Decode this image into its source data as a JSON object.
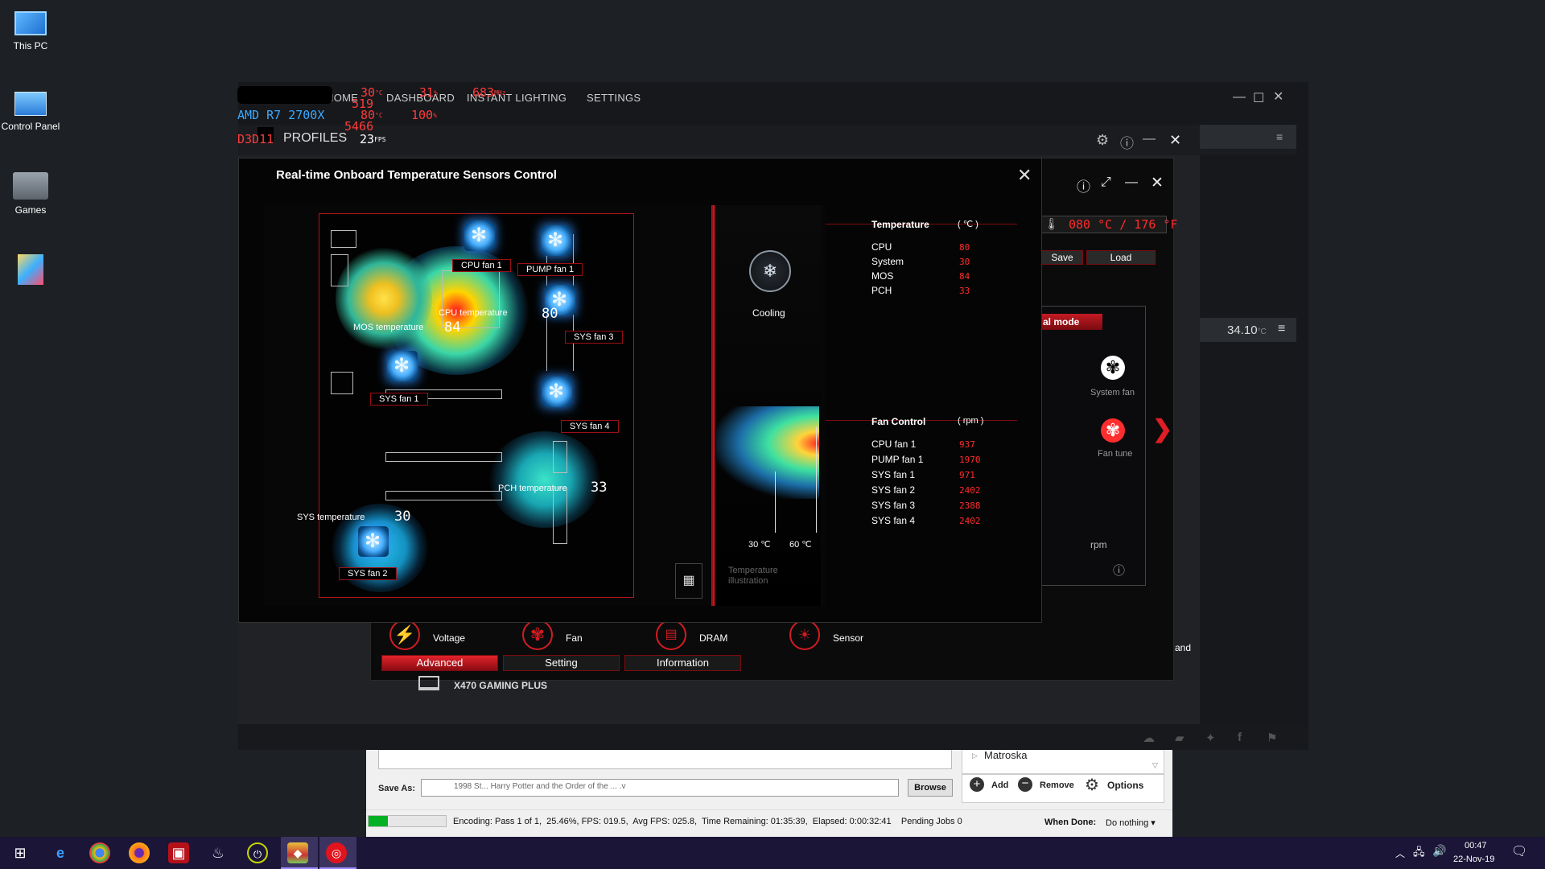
{
  "desktop": {
    "icons": [
      {
        "label": "This PC"
      },
      {
        "label": "Control Panel"
      },
      {
        "label": "Games"
      },
      {
        "label": ""
      }
    ]
  },
  "overlay": {
    "cpu_temp": "30",
    "cpu_temp_unit": "°C",
    "cpu_load": "31",
    "cpu_load_unit": "%",
    "cpu_clock": "683",
    "cpu_clock_unit": "MHz",
    "line2_value": "519",
    "cpu_name": "AMD R7 2700X",
    "gpu_temp": "80",
    "gpu_temp_unit": "°C",
    "gpu_load": "100",
    "gpu_load_unit": "%",
    "line4_value": "5466",
    "api": "D3D11",
    "fps": "23",
    "fps_unit": "FPS"
  },
  "main_nav": {
    "items": [
      "HOME",
      "DASHBOARD",
      "INSTANT LIGHTING",
      "SETTINGS"
    ],
    "profiles": "PROFILES"
  },
  "dialog": {
    "title": "Real-time Onboard Temperature Sensors Control",
    "labels": {
      "cpu_fan1": "CPU fan 1",
      "pump_fan1": "PUMP fan 1",
      "sys_fan3": "SYS fan 3",
      "sys_fan1": "SYS fan 1",
      "sys_fan4": "SYS fan 4",
      "sys_fan2": "SYS fan 2",
      "mos_temp": "MOS temperature",
      "cpu_temp": "CPU temperature",
      "pch_temp": "PCH temperature",
      "sys_temp": "SYS temperature"
    },
    "values": {
      "mos": "84",
      "cpu": "80",
      "pch": "33",
      "sys": "30"
    },
    "cooling": "Cooling",
    "scale_low": "30 ℃",
    "scale_high": "60 ℃",
    "temp_illus_1": "Temperature",
    "temp_illus_2": "illustration",
    "temperature": {
      "heading": "Temperature",
      "unit": "( ℃ )",
      "rows": [
        {
          "name": "CPU",
          "value": "80"
        },
        {
          "name": "System",
          "value": "30"
        },
        {
          "name": "MOS",
          "value": "84"
        },
        {
          "name": "PCH",
          "value": "33"
        }
      ]
    },
    "fan_control": {
      "heading": "Fan Control",
      "unit": "( rpm )",
      "rows": [
        {
          "name": "CPU fan 1",
          "value": "937"
        },
        {
          "name": "PUMP fan 1",
          "value": "1970"
        },
        {
          "name": "SYS fan 1",
          "value": "971"
        },
        {
          "name": "SYS fan 2",
          "value": "2402"
        },
        {
          "name": "SYS fan 3",
          "value": "2388"
        },
        {
          "name": "SYS fan 4",
          "value": "2402"
        }
      ]
    }
  },
  "behind": {
    "temp_readout": "080 °C / 176 °F",
    "save": "Save",
    "load": "Load",
    "mode_tab": "al mode",
    "system_fan": "System fan",
    "fan_tune": "Fan tune",
    "rpm": "rpm",
    "right_value": "34.10",
    "right_unit": "°C",
    "and": "and",
    "bottom_tabs": [
      {
        "label": "Voltage"
      },
      {
        "label": "Fan"
      },
      {
        "label": "DRAM"
      },
      {
        "label": "Sensor"
      }
    ],
    "buttons": [
      "Advanced",
      "Setting",
      "Information"
    ],
    "board_name": "X470 GAMING PLUS"
  },
  "handbrake": {
    "container": "Matroska",
    "save_as_label": "Save As:",
    "save_as_value": "1998 St... Harry Potter and the Order of the ... .v",
    "browse": "Browse",
    "add": "Add",
    "remove": "Remove",
    "options": "Options",
    "status": "Encoding: Pass 1 of 1,  25.46%, FPS: 019.5,  Avg FPS: 025.8,  Time Remaining: 01:35:39,  Elapsed: 0:00:32:41    Pending Jobs 0",
    "progress": 0.25,
    "when_done_label": "When Done:",
    "when_done_value": "Do nothing"
  },
  "taskbar": {
    "time": "00:47",
    "date": "22-Nov-19"
  }
}
